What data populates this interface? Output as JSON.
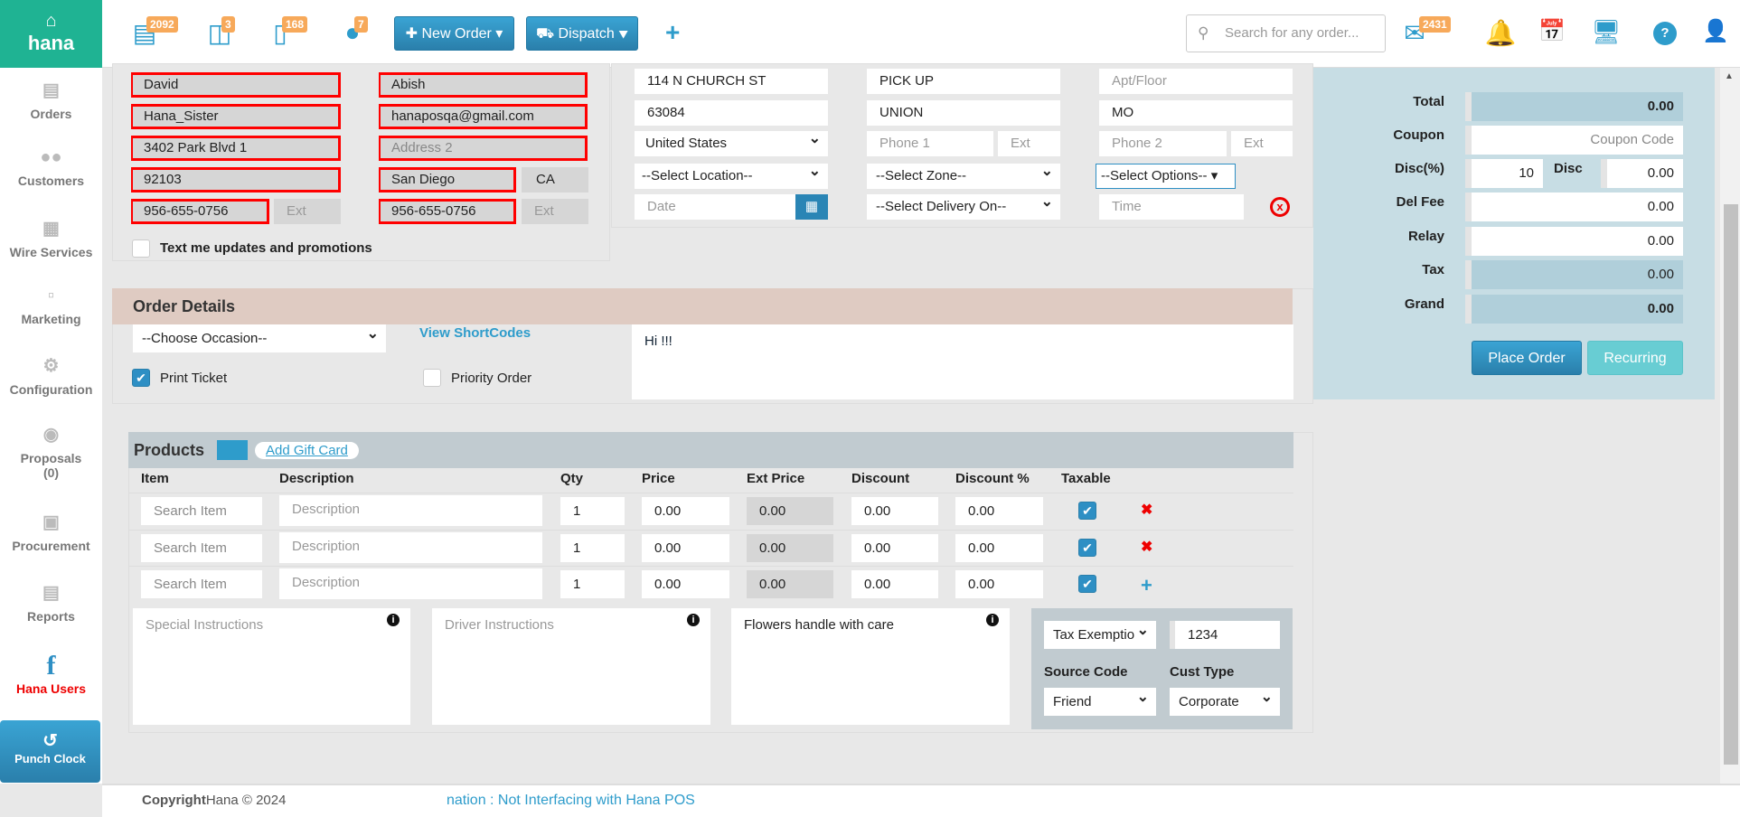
{
  "app": {
    "logo": "hana"
  },
  "topbar": {
    "badges": [
      {
        "icon": "orders-stack-icon",
        "count": "2092"
      },
      {
        "icon": "basket-icon",
        "count": "3"
      },
      {
        "icon": "tablet-icon",
        "count": "168"
      },
      {
        "icon": "chat-icon",
        "count": "7"
      }
    ],
    "new_order": "New Order",
    "dispatch": "Dispatch",
    "plus": "+",
    "search_placeholder": "Search for any order...",
    "mail_count": "2431"
  },
  "sidebar": {
    "items": [
      {
        "label": "Orders"
      },
      {
        "label": "Customers"
      },
      {
        "label": "Wire Services"
      },
      {
        "label": "Marketing"
      },
      {
        "label": "Configuration"
      },
      {
        "label": "Proposals (0)"
      },
      {
        "label": "Procurement"
      },
      {
        "label": "Reports"
      },
      {
        "label": "Hana Users"
      }
    ],
    "punch_clock": "Punch Clock"
  },
  "customer": {
    "first_name": "David",
    "last_name": "Abish",
    "company": "Hana_Sister",
    "email": "hanaposqa@gmail.com",
    "address1": "3402 Park Blvd 1",
    "address2_placeholder": "Address 2",
    "zip": "92103",
    "city": "San Diego",
    "state": "CA",
    "phone1": "956-655-0756",
    "ext1_placeholder": "Ext",
    "phone2": "956-655-0756",
    "ext2_placeholder": "Ext",
    "text_updates": "Text me updates and promotions"
  },
  "recipient": {
    "address": "114 N CHURCH ST",
    "name": "PICK UP",
    "apt_placeholder": "Apt/Floor",
    "zip": "63084",
    "city": "UNION",
    "state": "MO",
    "country": "United States",
    "phone1_placeholder": "Phone 1",
    "ext1_placeholder": "Ext",
    "phone2_placeholder": "Phone 2",
    "ext2_placeholder": "Ext",
    "location": "--Select Location--",
    "zone": "--Select Zone--",
    "options": "--Select Options--",
    "date_placeholder": "Date",
    "delivery_on": "--Select Delivery On--",
    "time_placeholder": "Time"
  },
  "summary": {
    "total_label": "Total",
    "total": "0.00",
    "coupon_label": "Coupon",
    "coupon_placeholder": "Coupon Code",
    "disc_pct_label": "Disc(%)",
    "disc_pct": "10",
    "disc_label": "Disc",
    "disc": "0.00",
    "del_fee_label": "Del Fee",
    "del_fee": "0.00",
    "relay_label": "Relay",
    "relay": "0.00",
    "tax_label": "Tax",
    "tax": "0.00",
    "grand_label": "Grand",
    "grand": "0.00",
    "place_order": "Place Order",
    "recurring": "Recurring"
  },
  "order_details": {
    "title": "Order Details",
    "occasion": "--Choose Occasion--",
    "shortcodes": "View ShortCodes",
    "message": "Hi !!!",
    "print_ticket": "Print Ticket",
    "priority_order": "Priority Order"
  },
  "products": {
    "title": "Products",
    "add_gift_card": "Add Gift Card",
    "columns": [
      "Item",
      "Description",
      "Qty",
      "Price",
      "Ext Price",
      "Discount",
      "Discount %",
      "Taxable"
    ],
    "rows": [
      {
        "item_placeholder": "Search Item",
        "desc_placeholder": "Description",
        "qty": "1",
        "price": "0.00",
        "ext_price": "0.00",
        "discount": "0.00",
        "discount_pct": "0.00",
        "taxable": true
      },
      {
        "item_placeholder": "Search Item",
        "desc_placeholder": "Description",
        "qty": "1",
        "price": "0.00",
        "ext_price": "0.00",
        "discount": "0.00",
        "discount_pct": "0.00",
        "taxable": true
      },
      {
        "item_placeholder": "Search Item",
        "desc_placeholder": "Description",
        "qty": "1",
        "price": "0.00",
        "ext_price": "0.00",
        "discount": "0.00",
        "discount_pct": "0.00",
        "taxable": true
      }
    ]
  },
  "instructions": {
    "special_placeholder": "Special Instructions",
    "driver_placeholder": "Driver Instructions",
    "card_message": "Flowers handle with care"
  },
  "tax": {
    "exemption": "Tax Exemptio",
    "exemption_no": "1234",
    "source_code_label": "Source Code",
    "cust_type_label": "Cust Type",
    "source_code": "Friend",
    "cust_type": "Corporate"
  },
  "footer": {
    "copyright_bold": "Copyright",
    "copyright": "Hana © 2024",
    "status": "nation : Not Interfacing with Hana POS"
  }
}
